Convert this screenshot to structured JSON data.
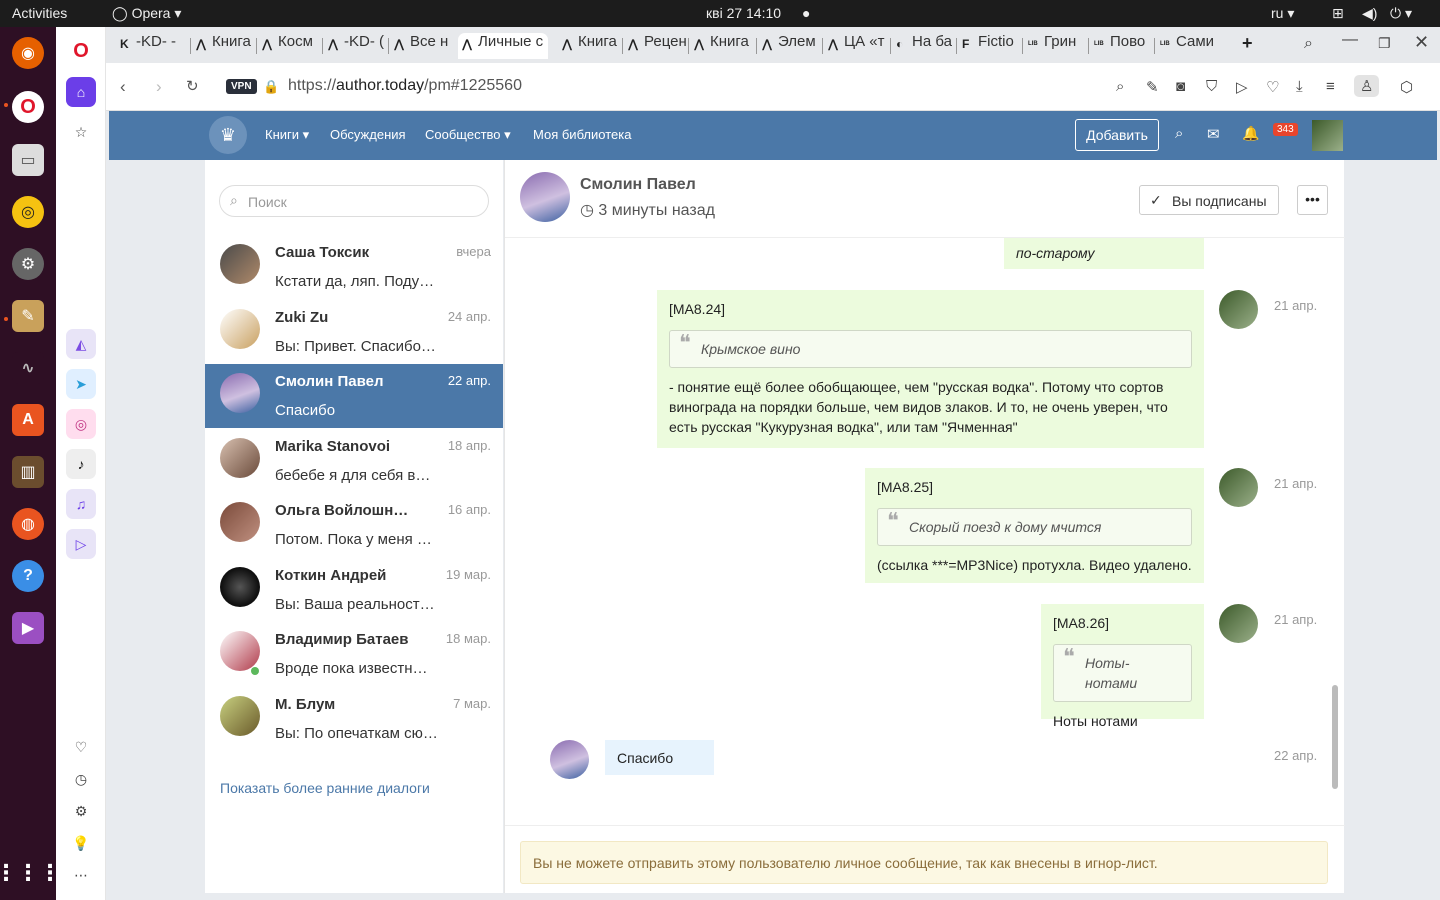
{
  "os": {
    "activities": "Activities",
    "app": "Opera",
    "clock": "кві 27  14:10",
    "lang": "ru"
  },
  "tabs": [
    "-KD- -",
    "Книга",
    "Косм",
    "-KD- (",
    "Все н",
    "Личные с",
    "Книга",
    "Рецен",
    "Книга",
    "Элем",
    "ЦА «т",
    "На ба",
    "Fictio",
    "Грин",
    "Пово",
    "Сами"
  ],
  "url": {
    "prefix": "https://",
    "domain": "author.today",
    "path": "/pm#1225560",
    "vpn": "VPN"
  },
  "nav": {
    "books": "Книги",
    "discussions": "Обсуждения",
    "community": "Сообщество",
    "library": "Моя библиотека",
    "add": "Добавить",
    "badge": "343"
  },
  "search": {
    "placeholder": "Поиск"
  },
  "dialogs": [
    {
      "name": "Саша Токсик",
      "date": "вчера",
      "preview": "Кстати да, ляп. Поду…"
    },
    {
      "name": "Zuki Zu",
      "date": "24 апр.",
      "preview": "Вы: Привет. Спасибо…"
    },
    {
      "name": "Смолин Павел",
      "date": "22 апр.",
      "preview": "Спасибо"
    },
    {
      "name": "Marika Stanovoi",
      "date": "18 апр.",
      "preview": "бебебе я для себя в…"
    },
    {
      "name": "Ольга Войлошн…",
      "date": "16 апр.",
      "preview": "Потом. Пока у меня …"
    },
    {
      "name": "Коткин Андрей",
      "date": "19 мар.",
      "preview": "Вы: Ваша реальност…"
    },
    {
      "name": "Владимир Батаев",
      "date": "18 мар.",
      "preview": "Вроде пока известн…"
    },
    {
      "name": "М. Блум",
      "date": "7 мар.",
      "preview": "Вы: По опечаткам сю…"
    }
  ],
  "earlier": "Показать более ранние диалоги",
  "chat": {
    "name": "Смолин Павел",
    "time": "3 минуты назад",
    "subscribed": "Вы подписаны",
    "topfragment": "по-старому",
    "messages": [
      {
        "tag": "[MA8.24]",
        "quote": "Крымское вино",
        "text": "- понятие ещё более обобщающее, чем \"русская водка\". Потому что сортов винограда на порядки больше, чем видов злаков. И то, не очень уверен, что есть русская \"Кукурузная водка\", или там \"Ячменная\"",
        "date": "21 апр."
      },
      {
        "tag": "[MA8.25]",
        "quote": "Скорый поезд к дому мчится",
        "text": "(ссылка ***=MP3Nice) протухла. Видео удалено.",
        "date": "21 апр."
      },
      {
        "tag": "[MA8.26]",
        "quote": "Ноты-нотами",
        "text": "Ноты нотами",
        "date": "21 апр."
      }
    ],
    "reply": {
      "text": "Спасибо",
      "date": "22 апр."
    },
    "warning": "Вы не можете отправить этому пользователю личное сообщение, так как внесены в игнор-лист."
  }
}
